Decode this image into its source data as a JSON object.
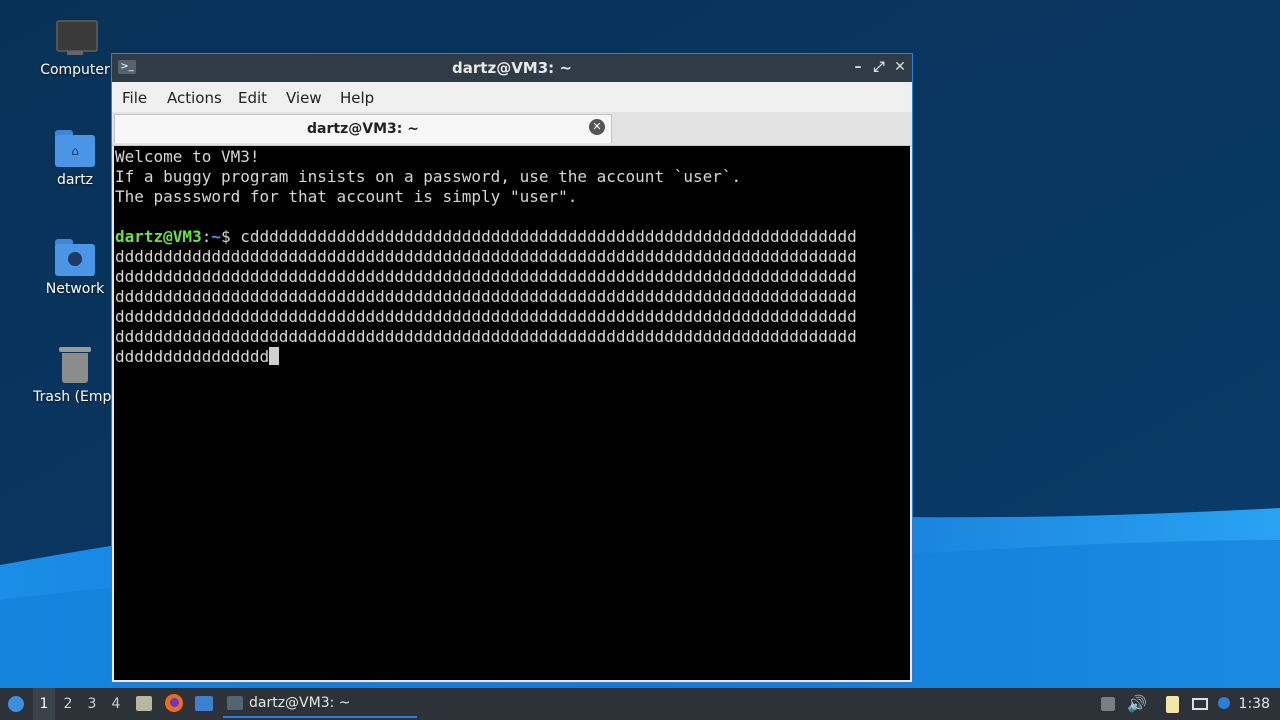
{
  "desktop": {
    "icons": [
      {
        "label": "Computer",
        "icon": "computer-icon"
      },
      {
        "label": "dartz",
        "icon": "home-folder-icon"
      },
      {
        "label": "Network",
        "icon": "network-folder-icon"
      },
      {
        "label": "Trash (Empt",
        "icon": "trash-icon"
      }
    ]
  },
  "window": {
    "title": "dartz@VM3: ~",
    "controls": {
      "minimize": "–",
      "maximize": "⤢",
      "close": "✕"
    },
    "menu": [
      "File",
      "Actions",
      "Edit",
      "View",
      "Help"
    ],
    "tab": {
      "title": "dartz@VM3: ~",
      "close": "✕"
    }
  },
  "terminal": {
    "welcome_lines": [
      "Welcome to VM3!",
      "If a buggy program insists on a password, use the account `user`.",
      "The passsword for that account is simply \"user\"."
    ],
    "prompt_user": "dartz@VM3",
    "prompt_sep": ":",
    "prompt_path": "~",
    "prompt_symbol": "$ ",
    "command_lines": [
      "cddddddddddddddddddddddddddddddddddddddddddddddddddddddddddddddd",
      "ddddddddddddddddddddddddddddddddddddddddddddddddddddddddddddddddddddddddddddd",
      "ddddddddddddddddddddddddddddddddddddddddddddddddddddddddddddddddddddddddddddd",
      "ddddddddddddddddddddddddddddddddddddddddddddddddddddddddddddddddddddddddddddd",
      "ddddddddddddddddddddddddddddddddddddddddddddddddddddddddddddddddddddddddddddd",
      "ddddddddddddddddddddddddddddddddddddddddddddddddddddddddddddddddddddddddddddd",
      "dddddddddddddddd"
    ]
  },
  "taskbar": {
    "workspaces": [
      "1",
      "2",
      "3",
      "4"
    ],
    "active_workspace": "1",
    "task_label": "dartz@VM3: ~",
    "clock": "1:38"
  },
  "colors": {
    "accent": "#2c7fd8",
    "wallpaper_dark": "#0b3a66",
    "wallpaper_light": "#1c8fe6",
    "prompt_user": "#6ce04a",
    "prompt_path": "#5b8ff0"
  }
}
